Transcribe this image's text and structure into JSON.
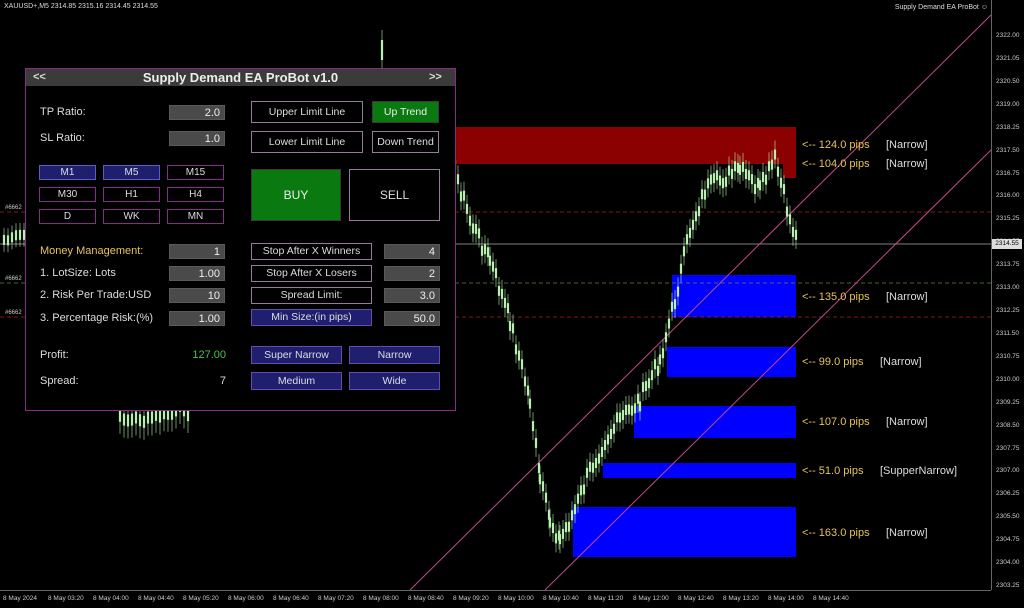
{
  "header": {
    "symbol_info": "XAUUSD+,M5  2314.85 2315.16 2314.45 2314.55",
    "brand": "Supply Demand EA ProBot"
  },
  "brand_icon": "smiley-icon",
  "y_axis": [
    "2322.00",
    "2321.05",
    "2320.50",
    "2319.00",
    "2318.25",
    "2317.50",
    "2316.75",
    "2316.00",
    "2315.25",
    "2314.55",
    "2313.75",
    "2313.00",
    "2312.25",
    "2311.50",
    "2310.75",
    "2310.00",
    "2309.25",
    "2308.50",
    "2307.75",
    "2307.00",
    "2306.25",
    "2305.50",
    "2304.75",
    "2304.00",
    "2303.25"
  ],
  "current_price": "2314.55",
  "x_axis": [
    "8 May 2024",
    "8 May 03:20",
    "8 May 04:00",
    "8 May 04:40",
    "8 May 05:20",
    "8 May 06:00",
    "8 May 06:40",
    "8 May 07:20",
    "8 May 08:00",
    "8 May 08:40",
    "8 May 09:20",
    "8 May 10:00",
    "8 May 10:40",
    "8 May 11:20",
    "8 May 12:00",
    "8 May 12:40",
    "8 May 13:20",
    "8 May 14:00",
    "8 May 14:40"
  ],
  "left_tags": [
    "#6662",
    "#6662",
    "#6662"
  ],
  "zones": [
    {
      "label": "<-- 124.0 pips",
      "tag": "[Narrow]",
      "type": "supply"
    },
    {
      "label": "<-- 104.0 pips",
      "tag": "[Narrow]",
      "type": "supply"
    },
    {
      "label": "<-- 135.0 pips",
      "tag": "[Narrow]",
      "type": "demand"
    },
    {
      "label": "<-- 99.0 pips",
      "tag": "[Narrow]",
      "type": "demand"
    },
    {
      "label": "<-- 107.0 pips",
      "tag": "[Narrow]",
      "type": "demand"
    },
    {
      "label": "<-- 51.0 pips",
      "tag": "[SupperNarrow]",
      "type": "demand"
    },
    {
      "label": "<-- 163.0 pips",
      "tag": "[Narrow]",
      "type": "demand"
    }
  ],
  "colors": {
    "supply": "#8b0000",
    "demand": "#0000ff",
    "bull": "#b8f0b0",
    "panel_border": "#8a2a8a",
    "accent_green": "#0a7a10",
    "gold": "#e8c35a"
  },
  "panel": {
    "title": "Supply Demand EA ProBot v1.0",
    "nav_left": "<<",
    "nav_right": ">>",
    "tp_label": "TP Ratio:",
    "tp_value": "2.0",
    "sl_label": "SL Ratio:",
    "sl_value": "1.0",
    "timeframes": [
      "M1",
      "M5",
      "M15",
      "M30",
      "H1",
      "H4",
      "D",
      "WK",
      "MN"
    ],
    "upper_limit": "Upper Limit Line",
    "lower_limit": "Lower Limit Line",
    "up_trend": "Up Trend",
    "down_trend": "Down Trend",
    "buy": "BUY",
    "sell": "SELL",
    "mm_label": "Money Management:",
    "mm_value": "1",
    "lot_label": "1. LotSize: Lots",
    "lot_value": "1.00",
    "risk_label": "2. Risk Per Trade:USD",
    "risk_value": "10",
    "pct_label": "3. Percentage Risk:(%)",
    "pct_value": "1.00",
    "stop_winners": "Stop After X Winners",
    "stop_winners_value": "4",
    "stop_losers": "Stop After X Losers",
    "stop_losers_value": "2",
    "spread_limit": "Spread Limit:",
    "spread_limit_value": "3.0",
    "min_size": "Min Size:(in pips)",
    "min_size_value": "50.0",
    "profit_label": "Profit:",
    "profit_value": "127.00",
    "spread_label": "Spread:",
    "spread_value": "7",
    "super_narrow": "Super Narrow",
    "narrow": "Narrow",
    "medium": "Medium",
    "wide": "Wide"
  }
}
